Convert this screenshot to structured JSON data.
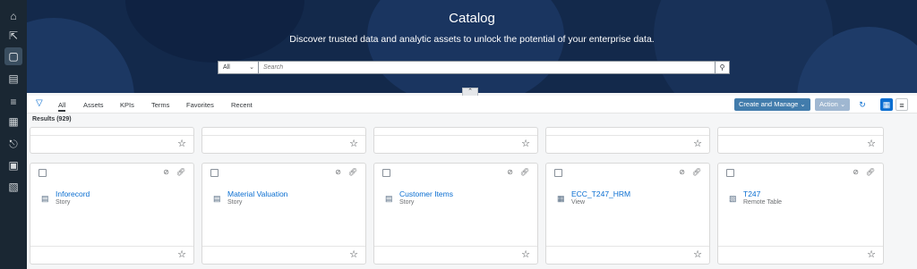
{
  "rail": {
    "icons": [
      "home-icon",
      "cursor-icon",
      "catalog-icon",
      "data-builder-icon",
      "data-access-icon",
      "business-builder-icon",
      "sharing-icon",
      "monitor-icon",
      "analytic-model-icon"
    ]
  },
  "hero": {
    "title": "Catalog",
    "subtitle": "Discover trusted data and analytic assets to unlock the potential of your enterprise data."
  },
  "search": {
    "scope": "All",
    "placeholder": "Search"
  },
  "toolbar": {
    "tabs": [
      "All",
      "Assets",
      "KPIs",
      "Terms",
      "Favorites",
      "Recent"
    ],
    "create_label": "Create and Manage",
    "action_label": "Action"
  },
  "results_label": "Results (929)",
  "cards": [
    {
      "name": "Inforecord",
      "type": "Story",
      "icon": "story-icon"
    },
    {
      "name": "Material Valuation",
      "type": "Story",
      "icon": "story-icon"
    },
    {
      "name": "Customer Items",
      "type": "Story",
      "icon": "story-icon"
    },
    {
      "name": "ECC_T247_HRM",
      "type": "View",
      "icon": "view-icon"
    },
    {
      "name": "T247",
      "type": "Remote Table",
      "icon": "remote-table-icon"
    }
  ],
  "colors": {
    "rail": "#1a2733",
    "hero": "#13294b",
    "accent": "#0a6ed1",
    "button": "#427cac"
  }
}
